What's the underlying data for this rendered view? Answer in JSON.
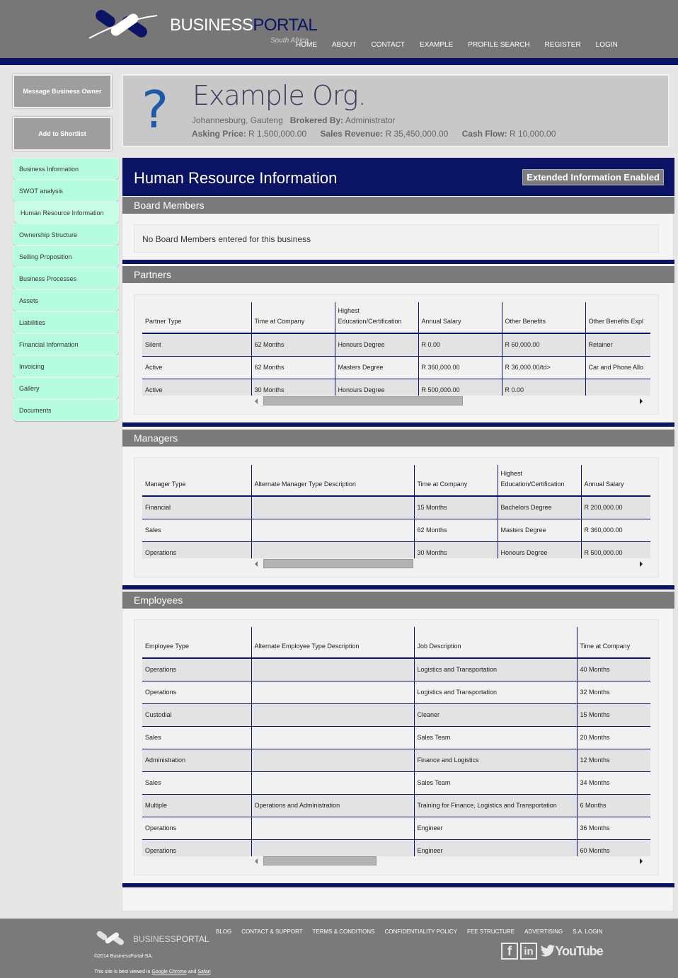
{
  "header": {
    "brand_left": "BUSINESS",
    "brand_right": "PORTAL",
    "brand_sub": "South Africa",
    "nav": [
      "HOME",
      "ABOUT",
      "CONTACT",
      "EXAMPLE",
      "PROFILE SEARCH",
      "REGISTER",
      "LOGIN"
    ]
  },
  "side_buttons": {
    "message": "Message Business Owner",
    "shortlist": "Add to Shortlist"
  },
  "side_menu": [
    "Business Information",
    "SWOT analysis",
    "Human Resource Information",
    "Ownership Structure",
    "Selling Proposition",
    "Business Processes",
    "Assets",
    "Liabilities",
    "Financial Information",
    "Invoicing",
    "Gallery",
    "Documents"
  ],
  "profile": {
    "name": "Example Org.",
    "location": "Johannesburg, Gauteng",
    "brokered_label": "Brokered By:",
    "brokered_value": "Administrator",
    "asking_label": "Asking Price:",
    "asking_value": "R 1,500,000.00",
    "revenue_label": "Sales Revenue:",
    "revenue_value": "R 35,450,000.00",
    "cashflow_label": "Cash Flow:",
    "cashflow_value": "R 10,000.00"
  },
  "main": {
    "title": "Human Resource Information",
    "badge": "Extended Information Enabled"
  },
  "board": {
    "title": "Board Members",
    "empty": "No Board Members entered for this business"
  },
  "partners": {
    "title": "Partners",
    "headers": [
      "Partner Type",
      "Time at Company",
      "Highest Education/Certification",
      "Annual Salary",
      "Other Benefits",
      "Other Benefits Expl"
    ],
    "rows": [
      [
        "Silent",
        "62 Months",
        "Honours Degree",
        "R 0.00",
        "R 60,000.00",
        "Retainer"
      ],
      [
        "Active",
        "62 Months",
        "Masters Degree",
        "R 360,000.00",
        "R 36,000.00/td>",
        "Car and Phone Allo"
      ],
      [
        "Active",
        "30 Months",
        "Honours Degree",
        "R 500,000.00",
        "R 0.00",
        ""
      ]
    ]
  },
  "managers": {
    "title": "Managers",
    "headers": [
      "Manager Type",
      "Alternate Manager Type Description",
      "Time at Company",
      "Highest Education/Certification",
      "Annual Salary"
    ],
    "rows": [
      [
        "Financial",
        "",
        "15 Months",
        "Bachelors Degree",
        "R 200,000.00"
      ],
      [
        "Sales",
        "",
        "62 Months",
        "Masters Degree",
        "R 360,000.00"
      ],
      [
        "Operations",
        "",
        "30 Months",
        "Honours Degree",
        "R 500,000.00"
      ]
    ]
  },
  "employees": {
    "title": "Employees",
    "headers": [
      "Employee Type",
      "Alternate Employee Type Description",
      "Job Description",
      "Time at Company"
    ],
    "rows": [
      [
        "Operations",
        "",
        "Logistics and Transportation",
        "40 Months"
      ],
      [
        "Operations",
        "",
        "Logistics and Transportation",
        "32 Months"
      ],
      [
        "Custodial",
        "",
        "Cleaner",
        "15 Months"
      ],
      [
        "Sales",
        "",
        "Sales Team",
        "20 Months"
      ],
      [
        "Administration",
        "",
        "Finance and Logistics",
        "12 Months"
      ],
      [
        "Sales",
        "",
        "Sales Team",
        "34 Months"
      ],
      [
        "Multiple",
        "Operations and Administration",
        "Training for Finance, Logistics and Transportation",
        "6 Months"
      ],
      [
        "Operations",
        "",
        "Engineer",
        "36 Months"
      ],
      [
        "Operations",
        "",
        "Engineer",
        "60 Months"
      ]
    ]
  },
  "footer": {
    "brand_left": "BUSINESS",
    "brand_right": "PORTAL",
    "links": [
      "BLOG",
      "CONTACT & SUPPORT",
      "TERMS & CONDITIONS",
      "CONFIDENTIALITY POLICY",
      "FEE STRUCTURE",
      "ADVERTISING",
      "S.A. LOGIN"
    ],
    "copyright": "©2014 BusinessPortal-SA.",
    "note_pre": "This site is best viewed in",
    "note_chrome": "Google Chrome",
    "note_and": "and",
    "note_safari": "Safari",
    "social": {
      "facebook": "f",
      "linkedin": "in",
      "youtube": "YouTube"
    }
  }
}
